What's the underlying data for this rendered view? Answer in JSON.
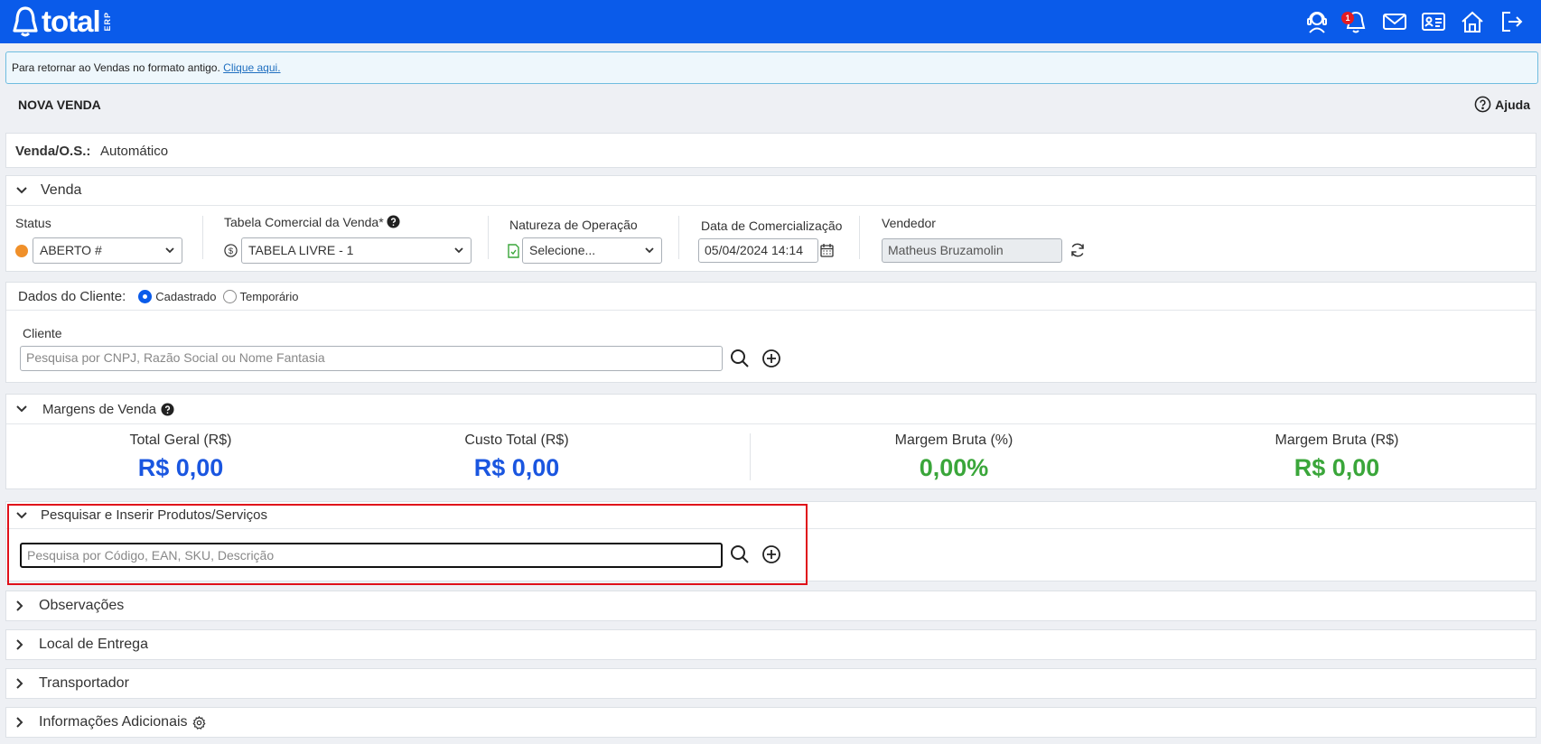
{
  "header": {
    "logo_text": "total",
    "logo_sub": "ERP",
    "notification_count": "1",
    "icons": [
      "support-agent-icon",
      "bell-icon",
      "mail-icon",
      "contact-card-icon",
      "home-icon",
      "logout-icon"
    ],
    "brand_color": "#0a5bea"
  },
  "notice": {
    "text": "Para retornar ao Vendas no formato antigo.",
    "link": "Clique aqui."
  },
  "page": {
    "title": "NOVA VENDA",
    "help_label": "Ajuda"
  },
  "order": {
    "label": "Venda/O.S.:",
    "value": "Automático"
  },
  "venda": {
    "section_title": "Venda",
    "status_label": "Status",
    "status_value": "ABERTO #",
    "status_color": "#f0902a",
    "tabela_label": "Tabela Comercial da Venda*",
    "tabela_value": "TABELA LIVRE - 1",
    "natureza_label": "Natureza de Operação",
    "natureza_value": "Selecione...",
    "data_label": "Data de Comercialização",
    "data_value": "05/04/2024 14:14",
    "vendedor_label": "Vendedor",
    "vendedor_value": "Matheus Bruzamolin"
  },
  "cliente": {
    "section_title": "Dados do Cliente:",
    "option_cadastrado": "Cadastrado",
    "option_temporario": "Temporário",
    "selected": "Cadastrado",
    "field_label": "Cliente",
    "placeholder": "Pesquisa por CNPJ, Razão Social ou Nome Fantasia"
  },
  "margens": {
    "section_title": "Margens de Venda",
    "items": [
      {
        "label": "Total Geral (R$)",
        "value": "R$ 0,00",
        "color": "#1a56e0"
      },
      {
        "label": "Custo Total (R$)",
        "value": "R$ 0,00",
        "color": "#1a56e0"
      },
      {
        "label": "Margem Bruta (%)",
        "value": "0,00%",
        "color": "#3aa63a"
      },
      {
        "label": "Margem Bruta (R$)",
        "value": "R$ 0,00",
        "color": "#3aa63a"
      }
    ]
  },
  "produtos": {
    "section_title": "Pesquisar e Inserir Produtos/Serviços",
    "placeholder": "Pesquisa por Código, EAN, SKU, Descrição",
    "highlight_color": "#e0101a"
  },
  "collapsed_sections": [
    "Observações",
    "Local de Entrega",
    "Transportador",
    "Informações Adicionais"
  ]
}
